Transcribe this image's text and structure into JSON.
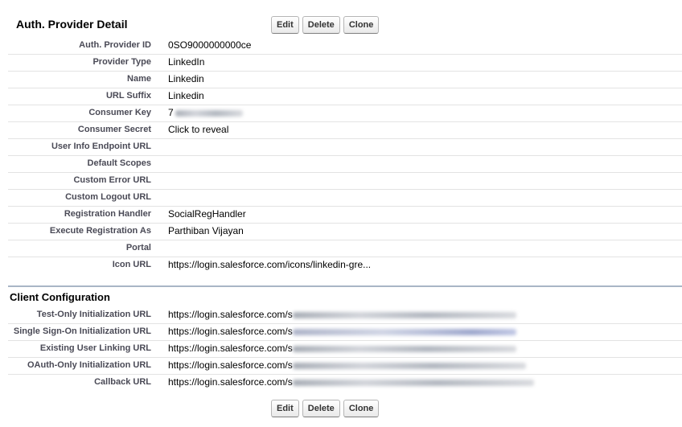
{
  "detail": {
    "title": "Auth. Provider Detail",
    "buttons": {
      "edit": "Edit",
      "delete": "Delete",
      "clone": "Clone"
    },
    "fields": [
      {
        "label": "Auth. Provider ID",
        "value": "0SO9000000000ce"
      },
      {
        "label": "Provider Type",
        "value": "LinkedIn"
      },
      {
        "label": "Name",
        "value": "Linkedin"
      },
      {
        "label": "URL Suffix",
        "value": "Linkedin"
      },
      {
        "label": "Consumer Key",
        "value": "7"
      },
      {
        "label": "Consumer Secret",
        "value": "Click to reveal"
      },
      {
        "label": "User Info Endpoint URL",
        "value": ""
      },
      {
        "label": "Default Scopes",
        "value": ""
      },
      {
        "label": "Custom Error URL",
        "value": ""
      },
      {
        "label": "Custom Logout URL",
        "value": ""
      },
      {
        "label": "Registration Handler",
        "value": "SocialRegHandler"
      },
      {
        "label": "Execute Registration As",
        "value": "Parthiban Vijayan"
      },
      {
        "label": "Portal",
        "value": ""
      },
      {
        "label": "Icon URL",
        "value": "https://login.salesforce.com/icons/linkedin-gre..."
      }
    ]
  },
  "client_config": {
    "title": "Client Configuration",
    "fields": [
      {
        "label": "Test-Only Initialization URL",
        "value": "https://login.salesforce.com/s"
      },
      {
        "label": "Single Sign-On Initialization URL",
        "value": "https://login.salesforce.com/s"
      },
      {
        "label": "Existing User Linking URL",
        "value": "https://login.salesforce.com/s"
      },
      {
        "label": "OAuth-Only Initialization URL",
        "value": "https://login.salesforce.com/s"
      },
      {
        "label": "Callback URL",
        "value": "https://login.salesforce.com/s"
      }
    ]
  }
}
